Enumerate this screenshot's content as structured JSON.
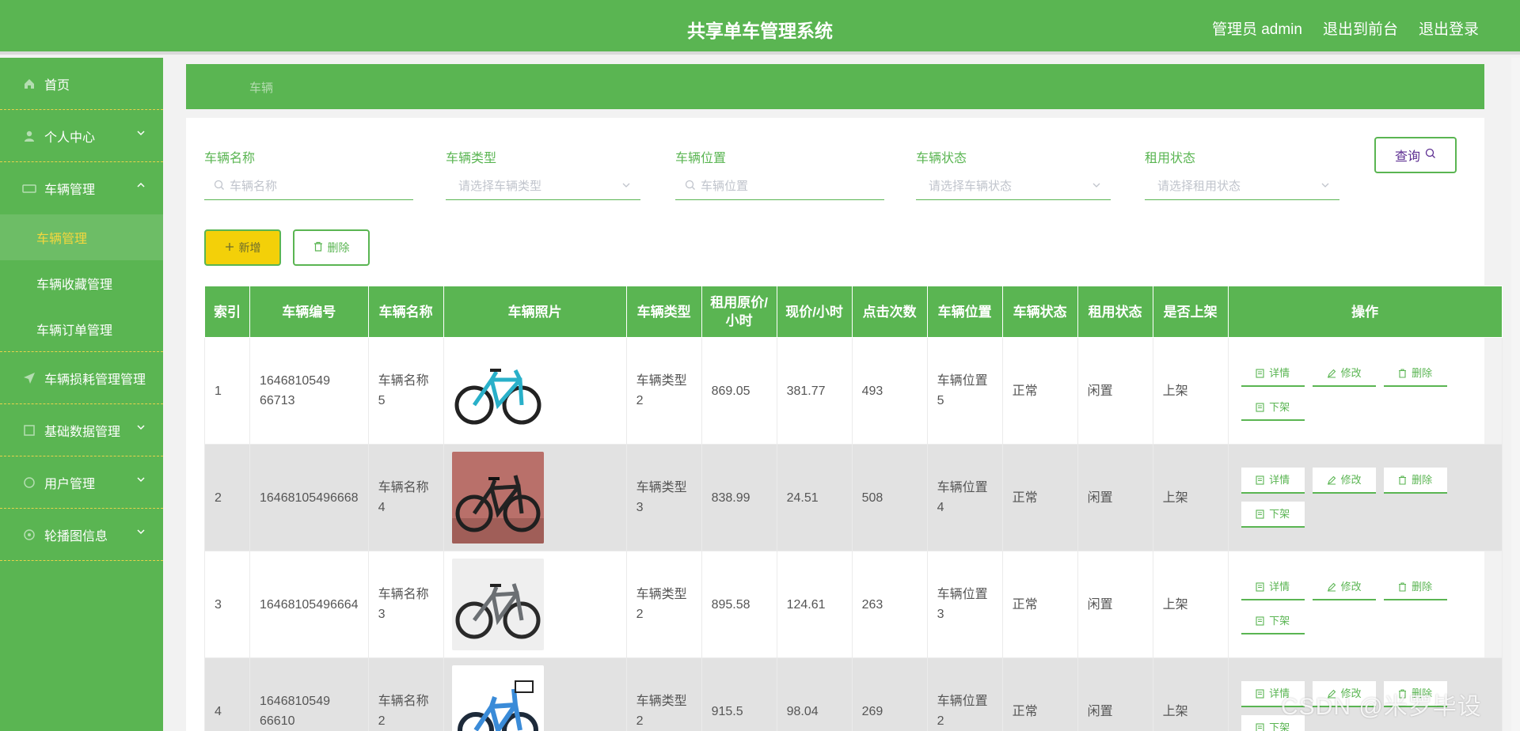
{
  "header": {
    "title": "共享单车管理系统",
    "user_label": "管理员 admin",
    "front_link": "退出到前台",
    "logout_link": "退出登录"
  },
  "sidebar": {
    "items": [
      {
        "label": "首页",
        "icon": "home-icon"
      },
      {
        "label": "个人中心",
        "icon": "user-icon"
      },
      {
        "label": "车辆管理",
        "icon": "bike-icon"
      },
      {
        "label": "车辆损耗管理管理",
        "icon": "send-icon"
      },
      {
        "label": "基础数据管理",
        "icon": "grid-icon"
      },
      {
        "label": "用户管理",
        "icon": "circle-icon"
      },
      {
        "label": "轮播图信息",
        "icon": "settings-icon"
      }
    ],
    "sub_items": [
      {
        "label": "车辆管理"
      },
      {
        "label": "车辆收藏管理"
      },
      {
        "label": "车辆订单管理"
      }
    ]
  },
  "breadcrumb": {
    "label": "车辆"
  },
  "filters": {
    "name_label": "车辆名称",
    "name_placeholder": "车辆名称",
    "type_label": "车辆类型",
    "type_placeholder": "请选择车辆类型",
    "location_label": "车辆位置",
    "location_placeholder": "车辆位置",
    "status_label": "车辆状态",
    "status_placeholder": "请选择车辆状态",
    "rent_label": "租用状态",
    "rent_placeholder": "请选择租用状态",
    "query_button": "查询"
  },
  "toolbar": {
    "add_button": "新增",
    "delete_button": "删除"
  },
  "table": {
    "headers": [
      "索引",
      "车辆编号",
      "车辆名称",
      "车辆照片",
      "车辆类型",
      "租用原价/小时",
      "现价/小时",
      "点击次数",
      "车辆位置",
      "车辆状态",
      "租用状态",
      "是否上架",
      "操作"
    ],
    "ops": {
      "detail": "详情",
      "edit": "修改",
      "delete": "删除",
      "unlist": "下架"
    },
    "rows": [
      {
        "index": "1",
        "code": "1646810549 66713",
        "name": "车辆名称5",
        "photo": "road-bike-teal",
        "type": "车辆类型2",
        "orig": "869.05",
        "price": "381.77",
        "clicks": "493",
        "location": "车辆位置5",
        "status": "正常",
        "rent": "闲置",
        "listed": "上架"
      },
      {
        "index": "2",
        "code": "16468105496668",
        "name": "车辆名称4",
        "photo": "road-bike-black",
        "type": "车辆类型3",
        "orig": "838.99",
        "price": "24.51",
        "clicks": "508",
        "location": "车辆位置4",
        "status": "正常",
        "rent": "闲置",
        "listed": "上架"
      },
      {
        "index": "3",
        "code": "16468105496664",
        "name": "车辆名称3",
        "photo": "mountain-bike-grey",
        "type": "车辆类型2",
        "orig": "895.58",
        "price": "124.61",
        "clicks": "263",
        "location": "车辆位置3",
        "status": "正常",
        "rent": "闲置",
        "listed": "上架"
      },
      {
        "index": "4",
        "code": "1646810549 66610",
        "name": "车辆名称2",
        "photo": "kids-bike-blue",
        "type": "车辆类型2",
        "orig": "915.5",
        "price": "98.04",
        "clicks": "269",
        "location": "车辆位置2",
        "status": "正常",
        "rent": "闲置",
        "listed": "上架"
      }
    ]
  },
  "watermark": "CSDN @米罗毕设",
  "colors": {
    "brand": "#5ab552",
    "accent": "#f3d009",
    "divider": "#e8d24b"
  }
}
